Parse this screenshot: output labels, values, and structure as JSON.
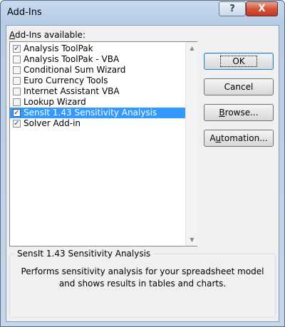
{
  "window": {
    "title": "Add-Ins",
    "help_label": "?",
    "close_label": "X"
  },
  "list": {
    "label_accel": "A",
    "label_rest": "dd-Ins available:",
    "items": [
      {
        "label": "Analysis ToolPak",
        "checked": true,
        "selected": false
      },
      {
        "label": "Analysis ToolPak - VBA",
        "checked": false,
        "selected": false
      },
      {
        "label": "Conditional Sum Wizard",
        "checked": false,
        "selected": false
      },
      {
        "label": "Euro Currency Tools",
        "checked": false,
        "selected": false
      },
      {
        "label": "Internet Assistant VBA",
        "checked": false,
        "selected": false
      },
      {
        "label": "Lookup Wizard",
        "checked": false,
        "selected": false
      },
      {
        "label": "SensIt 1.43 Sensitivity Analysis",
        "checked": true,
        "selected": true
      },
      {
        "label": "Solver Add-in",
        "checked": true,
        "selected": false
      }
    ]
  },
  "buttons": {
    "ok": "OK",
    "cancel": "Cancel",
    "browse_accel": "B",
    "browse_rest": "rowse...",
    "automation_pre": "A",
    "automation_accel": "u",
    "automation_rest": "tomation..."
  },
  "description": {
    "title": "SensIt 1.43 Sensitivity Analysis",
    "text": "Performs sensitivity analysis for your spreadsheet model and shows results in tables and charts."
  }
}
